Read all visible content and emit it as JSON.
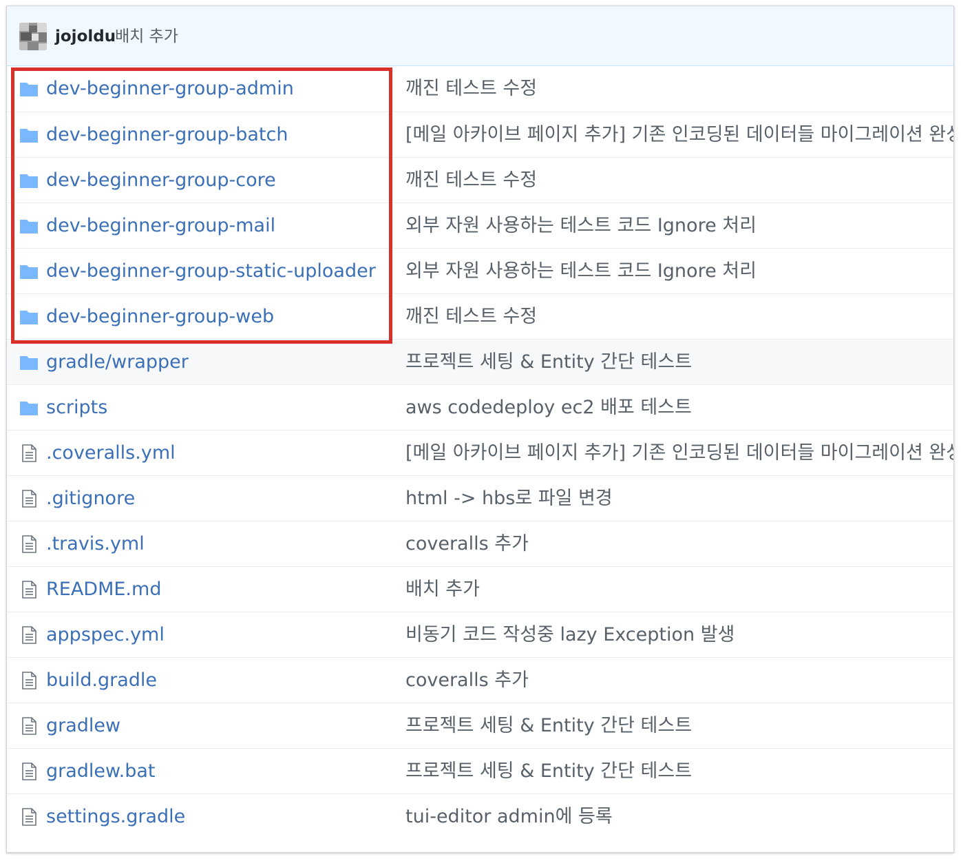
{
  "commit": {
    "author": "jojoldu",
    "message": "배치 추가"
  },
  "colors": {
    "link": "#3b6fb6",
    "message": "#586069",
    "folder": "#79b8ff",
    "highlight": "#d9302a",
    "header_bg": "#f1f8ff"
  },
  "files": [
    {
      "type": "folder",
      "icon": "folder-icon",
      "name": "dev-beginner-group-admin",
      "message": "깨진 테스트 수정"
    },
    {
      "type": "folder",
      "icon": "folder-icon",
      "name": "dev-beginner-group-batch",
      "message": "[메일 아카이브 페이지 추가] 기존 인코딩된 데이터들 마이그레이션 완성"
    },
    {
      "type": "folder",
      "icon": "folder-icon",
      "name": "dev-beginner-group-core",
      "message": "깨진 테스트 수정"
    },
    {
      "type": "folder",
      "icon": "folder-icon",
      "name": "dev-beginner-group-mail",
      "message": "외부 자원 사용하는 테스트 코드 Ignore 처리"
    },
    {
      "type": "folder",
      "icon": "folder-icon",
      "name": "dev-beginner-group-static-uploader",
      "message": "외부 자원 사용하는 테스트 코드 Ignore 처리"
    },
    {
      "type": "folder",
      "icon": "folder-icon",
      "name": "dev-beginner-group-web",
      "message": "깨진 테스트 수정"
    },
    {
      "type": "folder",
      "icon": "folder-icon",
      "name": "gradle/wrapper",
      "message": "프로젝트 세팅 & Entity 간단 테스트"
    },
    {
      "type": "folder",
      "icon": "folder-icon",
      "name": "scripts",
      "message": "aws codedeploy ec2 배포 테스트"
    },
    {
      "type": "file",
      "icon": "file-icon",
      "name": ".coveralls.yml",
      "message": "[메일 아카이브 페이지 추가] 기존 인코딩된 데이터들 마이그레이션 완성"
    },
    {
      "type": "file",
      "icon": "file-icon",
      "name": ".gitignore",
      "message": "html -> hbs로 파일 변경"
    },
    {
      "type": "file",
      "icon": "file-icon",
      "name": ".travis.yml",
      "message": "coveralls 추가"
    },
    {
      "type": "file",
      "icon": "file-icon",
      "name": "README.md",
      "message": "배치 추가"
    },
    {
      "type": "file",
      "icon": "file-icon",
      "name": "appspec.yml",
      "message": "비동기 코드 작성중 lazy Exception 발생"
    },
    {
      "type": "file",
      "icon": "file-icon",
      "name": "build.gradle",
      "message": "coveralls 추가"
    },
    {
      "type": "file",
      "icon": "file-icon",
      "name": "gradlew",
      "message": "프로젝트 세팅 & Entity 간단 테스트"
    },
    {
      "type": "file",
      "icon": "file-icon",
      "name": "gradlew.bat",
      "message": "프로젝트 세팅 & Entity 간단 테스트"
    },
    {
      "type": "file",
      "icon": "file-icon",
      "name": "settings.gradle",
      "message": "tui-editor admin에 등록"
    }
  ]
}
